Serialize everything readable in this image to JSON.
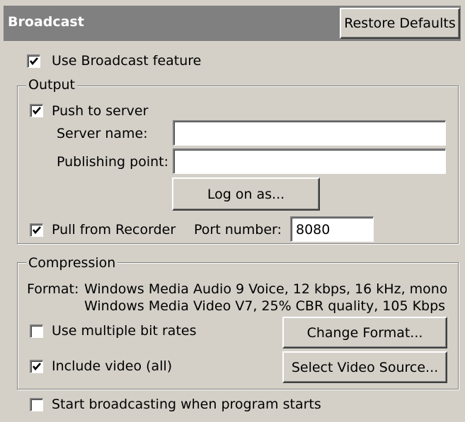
{
  "header": {
    "title": "Broadcast",
    "restore_label": "Restore Defaults"
  },
  "use_broadcast": {
    "label": "Use Broadcast feature",
    "checked": true
  },
  "output": {
    "legend": "Output",
    "push": {
      "label": "Push to server",
      "checked": true
    },
    "server_name_label": "Server name:",
    "server_name_value": "",
    "publishing_point_label": "Publishing point:",
    "publishing_point_value": "",
    "logon_label": "Log on as...",
    "pull": {
      "label": "Pull from Recorder",
      "checked": true
    },
    "port_label": "Port number:",
    "port_value": "8080"
  },
  "compression": {
    "legend": "Compression",
    "format_label": "Format:",
    "audio_format": "Windows Media Audio 9 Voice, 12 kbps, 16 kHz, mono",
    "video_format": "Windows Media Video V7, 25% CBR quality, 105 Kbps",
    "multiple_bitrates": {
      "label": "Use multiple bit rates",
      "checked": false
    },
    "include_video": {
      "label": "Include video (all)",
      "checked": true
    },
    "change_format_label": "Change Format...",
    "select_video_label": "Select Video Source..."
  },
  "start_broadcasting": {
    "label": "Start broadcasting when program starts",
    "checked": false
  }
}
